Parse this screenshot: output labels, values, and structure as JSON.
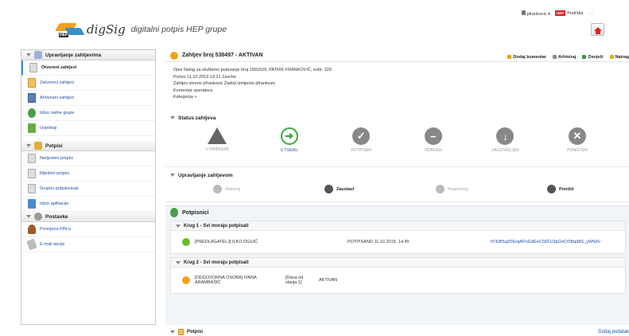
{
  "header": {
    "brand": "digSig",
    "subtitle": "digitalni potpis HEP grupe",
    "user": "pfrankovic",
    "support": "Podrška",
    "dots": "...",
    "logo_tag": "HEP"
  },
  "sidebar": {
    "sections": [
      {
        "title": "Upravljanje zahtjevima",
        "items": [
          {
            "label": "Otvoreni zahtjevi",
            "icon": "document-icon"
          },
          {
            "label": "Zatvoreni zahtjevi",
            "icon": "document-yellow-icon"
          },
          {
            "label": "Arhivirani zahtjevi",
            "icon": "archive-icon"
          },
          {
            "label": "Izbor radne grupe",
            "icon": "group-icon"
          },
          {
            "label": "Izvještaji",
            "icon": "report-icon"
          }
        ]
      },
      {
        "title": "Potpisi",
        "items": [
          {
            "label": "Neriješeni potpisi",
            "icon": "document-icon"
          },
          {
            "label": "Riješeni potpisi",
            "icon": "document-icon"
          },
          {
            "label": "Grupno potpisivanje",
            "icon": "document-icon"
          },
          {
            "label": "Izbor aplikacije",
            "icon": "app-icon"
          }
        ]
      },
      {
        "title": "Postavke",
        "items": [
          {
            "label": "Promjena PIN-a",
            "icon": "user-icon"
          },
          {
            "label": "E-mail opcije",
            "icon": "mail-icon"
          }
        ]
      }
    ]
  },
  "request": {
    "title": "Zahtjev broj 538497 - AKTIVAN",
    "actions": [
      "Dodaj komentar",
      "Arhiviraj",
      "Osvježi",
      "Natrag"
    ],
    "opis": "Opis  Nalog za službeno putovanje broj 1901629, PATRIK FRANKOVIĆ, evbr: 103",
    "pocelo": "Počeo  11.10.2019 13:21     Završio",
    "stvorio": "Zahtjev stvorio  pfrankovic  Zadnji izmijenio  pfrankovic",
    "komentar": "Komentar operatera",
    "kategorija": "Kategorija"
  },
  "status": {
    "title": "Status zahtjeva",
    "steps": [
      "U PRIPREMI",
      "U TIJEKU",
      "POTPISAN",
      "ODBIJEN",
      "ZAUSTAVLJEN",
      "PONIŠTEN"
    ]
  },
  "management": {
    "title": "Upravljanje zahtjevom",
    "buttons": [
      "Aktiviraj",
      "Zaustavi",
      "Reaktiviraj",
      "Poništi"
    ]
  },
  "signers": {
    "title": "Potpisnici",
    "rounds": [
      {
        "title": "Krug 1 - Svi moraju potpisati",
        "rows": [
          {
            "who": "[PREDLAGATELJ] ILKO OGUIĆ",
            "extra": "",
            "status": "POTPISANO  11.10.2019. 14:45",
            "hash": "fV3vB5qZ56oqAPoGdEeC0ZFU3pOeCt5Bqd8S_yW5dV"
          }
        ]
      },
      {
        "title": "Krug 2 - Svi moraju potpisati",
        "rows": [
          {
            "who": "[ODGOVORNA OSOBA] IVANA ARAMBAŠIĆ",
            "extra": "[Dana od slanja:1]",
            "status": "AKTIVAN",
            "hash": ""
          }
        ]
      }
    ]
  },
  "bottom": {
    "title": "Potpisi",
    "right": "Dodaj podatak"
  }
}
